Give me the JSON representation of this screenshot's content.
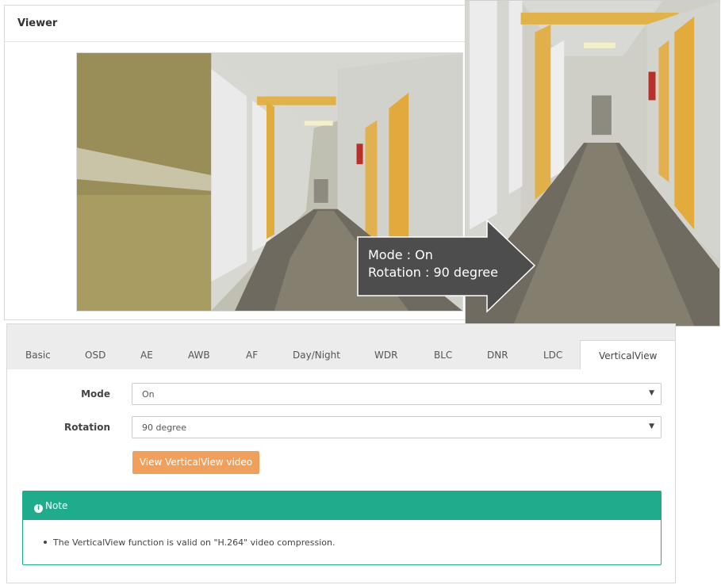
{
  "viewer": {
    "title": "Viewer"
  },
  "callout": {
    "line1": "Mode : On",
    "line2": "Rotation : 90 degree"
  },
  "tabs": [
    {
      "label": "Basic"
    },
    {
      "label": "OSD"
    },
    {
      "label": "AE"
    },
    {
      "label": "AWB"
    },
    {
      "label": "AF"
    },
    {
      "label": "Day/Night"
    },
    {
      "label": "WDR"
    },
    {
      "label": "BLC"
    },
    {
      "label": "DNR"
    },
    {
      "label": "LDC"
    },
    {
      "label": "VerticalView",
      "active": true
    }
  ],
  "form": {
    "mode_label": "Mode",
    "mode_value": "On",
    "rotation_label": "Rotation",
    "rotation_value": "90 degree",
    "caret": "▼",
    "button_label": "View VerticalView video"
  },
  "note": {
    "icon_glyph": "i",
    "title": "Note",
    "text": "The VerticalView function is valid on \"H.264\" video compression."
  },
  "colors": {
    "accent_button": "#f0a05c",
    "note_teal": "#1fac8c",
    "callout_bg": "#4d4d4d"
  }
}
